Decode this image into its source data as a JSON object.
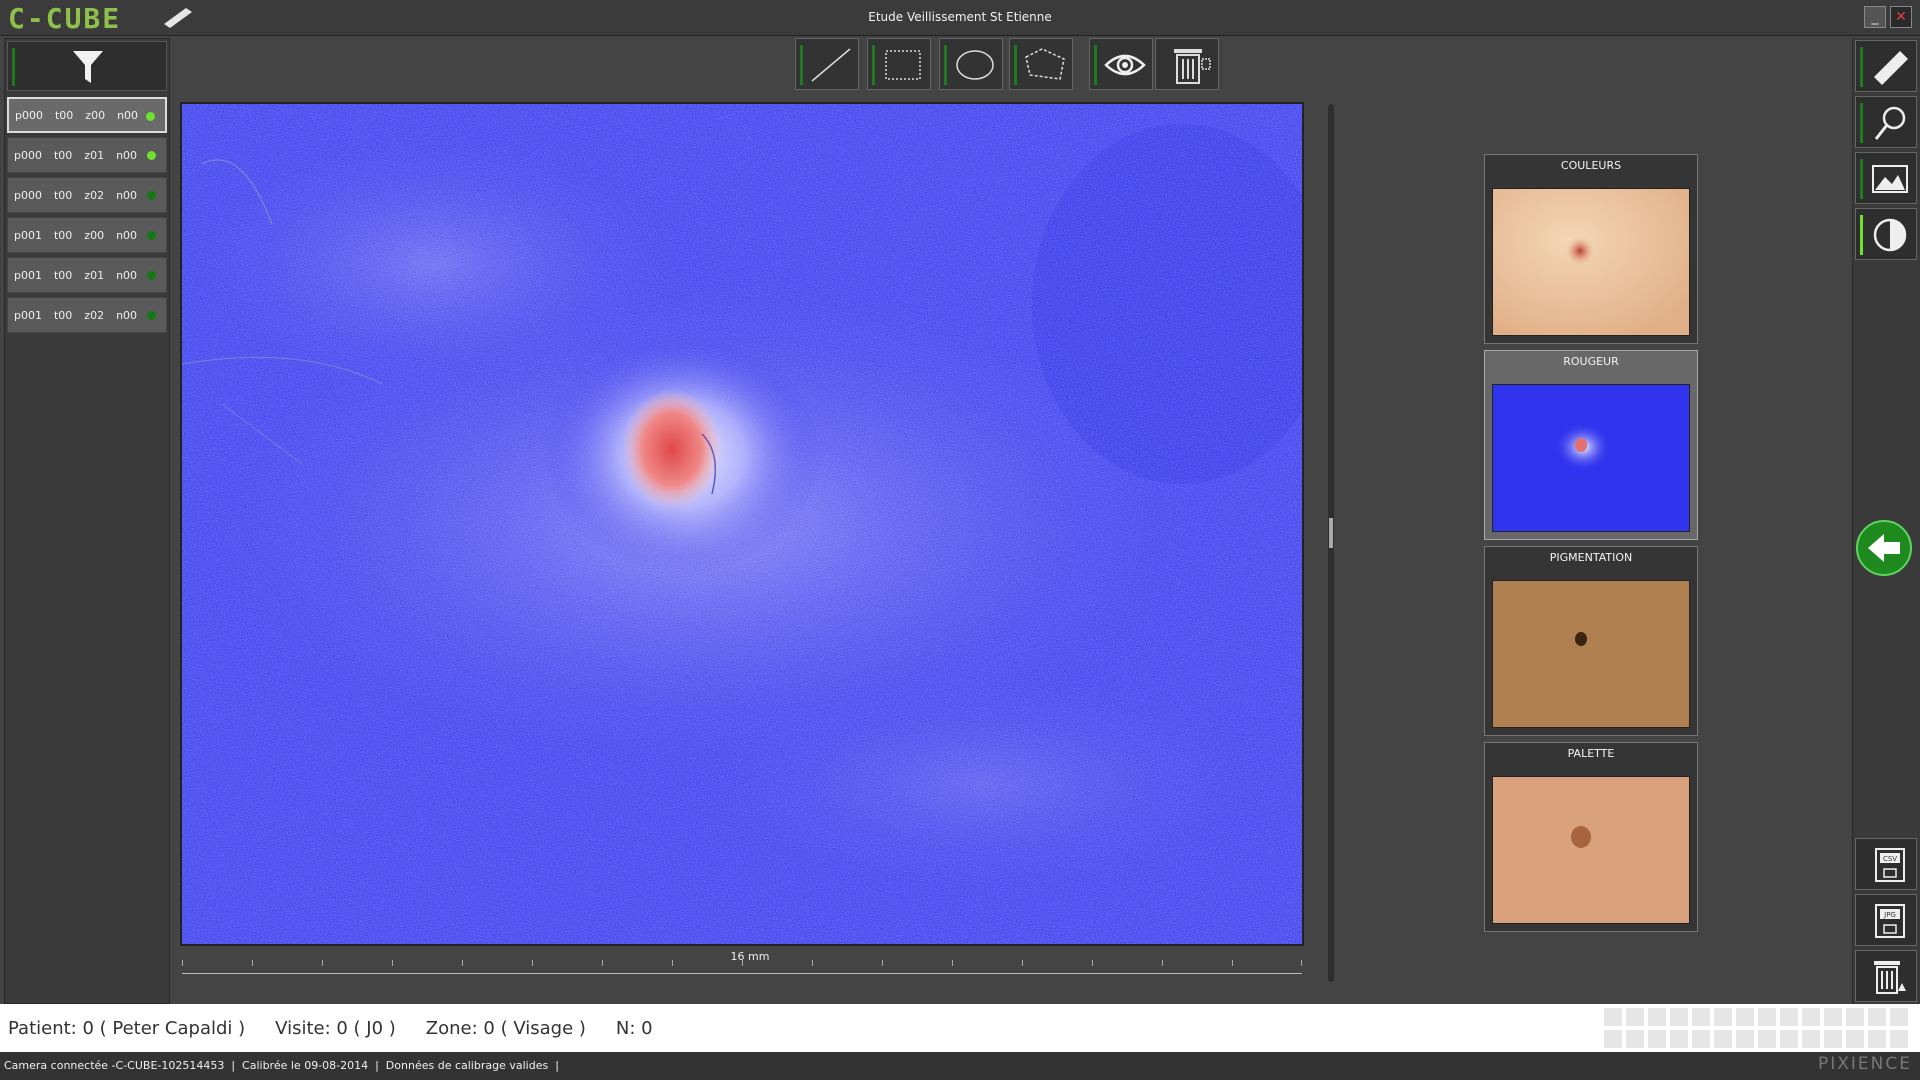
{
  "app": {
    "logo": "C-CUBE",
    "title": "Etude Veillissement St Etienne",
    "minimize": "_",
    "close": "✕"
  },
  "sidebar": {
    "filter_icon": "filter-icon",
    "items": [
      {
        "p": "p000",
        "t": "t00",
        "z": "z00",
        "n": "n00",
        "status": "active"
      },
      {
        "p": "p000",
        "t": "t00",
        "z": "z01",
        "n": "n00",
        "status": "bright"
      },
      {
        "p": "p000",
        "t": "t00",
        "z": "z02",
        "n": "n00",
        "status": "normal"
      },
      {
        "p": "p001",
        "t": "t00",
        "z": "z00",
        "n": "n00",
        "status": "normal"
      },
      {
        "p": "p001",
        "t": "t00",
        "z": "z01",
        "n": "n00",
        "status": "normal"
      },
      {
        "p": "p001",
        "t": "t00",
        "z": "z02",
        "n": "n00",
        "status": "normal"
      }
    ]
  },
  "toolbar": {
    "tools": [
      "line-tool-icon",
      "rectangle-tool-icon",
      "ellipse-tool-icon",
      "polygon-tool-icon",
      "eye-icon",
      "trash-icon"
    ]
  },
  "main": {
    "scale_label": "16  mm"
  },
  "thumbnails": [
    {
      "label": "COULEURS",
      "selected": false
    },
    {
      "label": "ROUGEUR",
      "selected": true
    },
    {
      "label": "PIGMENTATION",
      "selected": false
    },
    {
      "label": "PALETTE",
      "selected": false
    }
  ],
  "right_toolbar": {
    "tools": [
      "ruler-icon",
      "magnifier-icon",
      "image-icon",
      "contrast-icon"
    ],
    "export": [
      "csv-export-icon",
      "jpg-export-icon",
      "delete-images-icon"
    ],
    "csv_label": "CSV",
    "jpg_label": "JPG",
    "back": "back-arrow-icon"
  },
  "info": {
    "patient": "Patient: 0 ( Peter Capaldi )",
    "visit": "Visite: 0 ( J0 )",
    "zone": "Zone: 0 ( Visage )",
    "n": "N: 0"
  },
  "status": {
    "text": "Camera connectée -C-CUBE-102514453  |  Calibrée le 09-08-2014  |  Données de calibrage valides  |",
    "brand": "PIXIENCE"
  },
  "colors": {
    "accent_green": "#8fc04a",
    "indicator_green": "#1f7a1f",
    "rougeur_blue": "#2b2ff0",
    "highlight_red": "#e06060"
  }
}
